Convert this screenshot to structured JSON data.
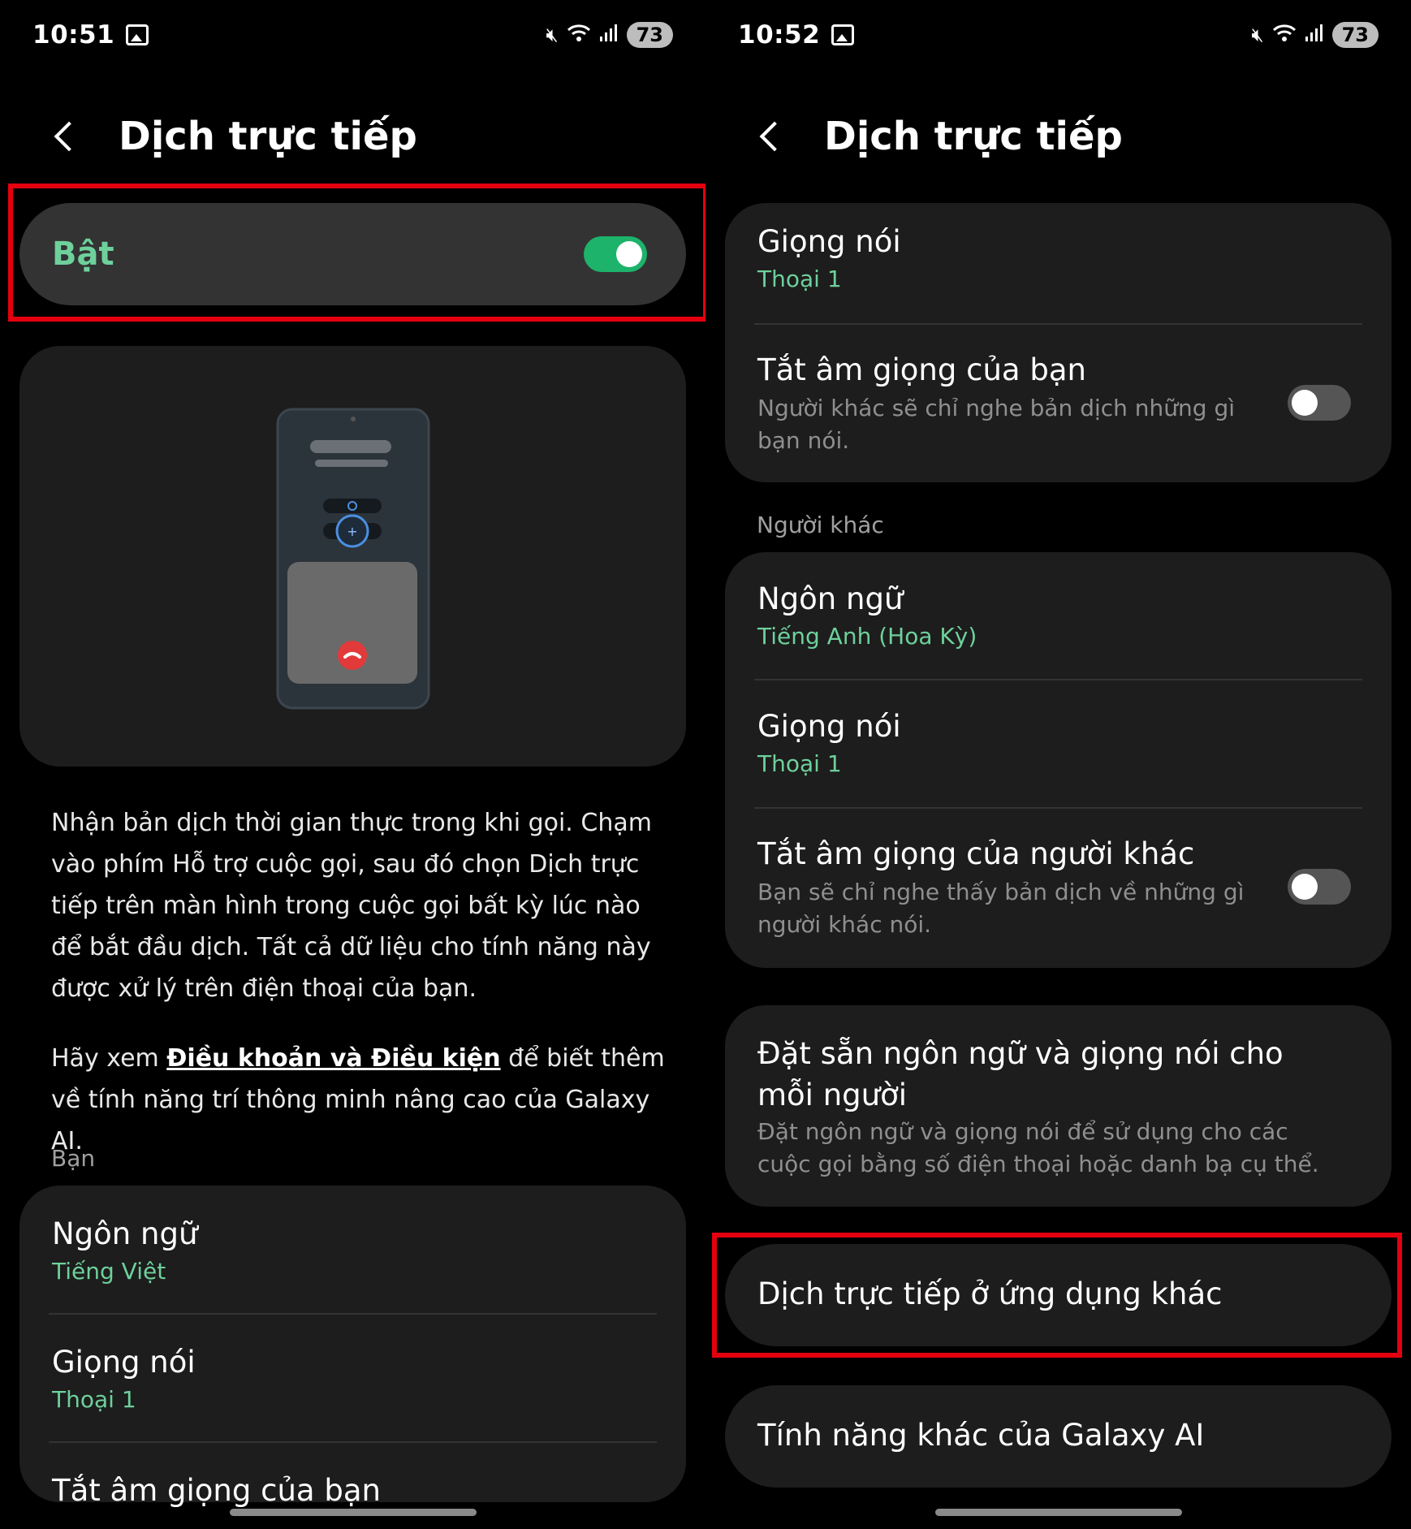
{
  "left": {
    "status": {
      "time": "10:51",
      "battery": "73"
    },
    "header": {
      "title": "Dịch trực tiếp"
    },
    "master_toggle": {
      "label": "Bật",
      "state": "on"
    },
    "description": {
      "paragraph1": "Nhận bản dịch thời gian thực trong khi gọi. Chạm vào phím Hỗ trợ cuộc gọi, sau đó chọn Dịch trực tiếp trên màn hình trong cuộc gọi bất kỳ lúc nào để bắt đầu dịch. Tất cả dữ liệu cho tính năng này được xử lý trên điện thoại của bạn.",
      "p2_before": "Hãy xem ",
      "p2_link": "Điều khoản và Điều kiện",
      "p2_after": " để biết thêm về tính năng trí thông minh nâng cao của Galaxy AI."
    },
    "section_you": "Bạn",
    "you_items": [
      {
        "title": "Ngôn ngữ",
        "value": "Tiếng Việt"
      },
      {
        "title": "Giọng nói",
        "value": "Thoại 1"
      },
      {
        "title": "Tắt âm giọng của bạn"
      }
    ]
  },
  "right": {
    "status": {
      "time": "10:52",
      "battery": "73"
    },
    "header": {
      "title": "Dịch trực tiếp"
    },
    "voice": {
      "title": "Giọng nói",
      "value": "Thoại 1"
    },
    "mute_you": {
      "title": "Tắt âm giọng của bạn",
      "desc": "Người khác sẽ chỉ nghe bản dịch những gì bạn nói.",
      "state": "off"
    },
    "section_others": "Người khác",
    "others_language": {
      "title": "Ngôn ngữ",
      "value": "Tiếng Anh (Hoa Kỳ)"
    },
    "others_voice": {
      "title": "Giọng nói",
      "value": "Thoại 1"
    },
    "mute_others": {
      "title": "Tắt âm giọng của người khác",
      "desc": "Bạn sẽ chỉ nghe thấy bản dịch về những gì người khác nói.",
      "state": "off"
    },
    "preset": {
      "title": "Đặt sẵn ngôn ngữ và giọng nói cho mỗi người",
      "desc": "Đặt ngôn ngữ và giọng nói để sử dụng cho các cuộc gọi bằng số điện thoại hoặc danh bạ cụ thể."
    },
    "other_apps": {
      "title": "Dịch trực tiếp ở ứng dụng khác"
    },
    "galaxy_ai": {
      "title": "Tính năng khác của Galaxy AI"
    }
  },
  "colors": {
    "accent_green": "#6ed09b",
    "toggle_on": "#1db36a",
    "highlight_red": "#e4000f",
    "card_bg": "#1d1d1d"
  }
}
